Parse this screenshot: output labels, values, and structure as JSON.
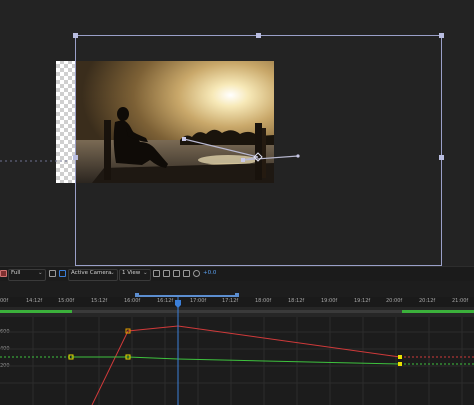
{
  "viewer": {
    "background": "#232323",
    "bbox_color": "#9aa0c8",
    "path_color": "#b8b8d0",
    "image_alt": "Silhouette of a person sitting on a wooden pier at sunset over the water"
  },
  "toolbar": {
    "resolution": "Full",
    "view": "Active Camera",
    "views_count": "1 View",
    "exposure": "+0.0",
    "icons": [
      "resolution-dropdown-icon",
      "region-of-interest-icon",
      "grid-icon",
      "camera-dropdown-icon",
      "views-dropdown-icon",
      "composition-flowchart-icon",
      "fast-preview-icon",
      "reset-exposure-icon",
      "exposure-icon"
    ]
  },
  "timeline": {
    "ruler_ticks": [
      "00f",
      "14:12f",
      "15:00f",
      "15:12f",
      "16:00f",
      "16:12f",
      "17:00f",
      "17:12f",
      "18:00f",
      "18:12f",
      "19:00f",
      "19:12f",
      "20:00f",
      "20:12f",
      "21:00f"
    ],
    "y_labels": [
      "600",
      "400",
      "200"
    ],
    "colors": {
      "red_curve": "#d03a3a",
      "green_curve": "#3ec23e",
      "playhead": "#3b7fd9",
      "keyframe": "#e8e000",
      "work_area": "#5c8ed0",
      "range_bar": "#3bb03b"
    }
  }
}
